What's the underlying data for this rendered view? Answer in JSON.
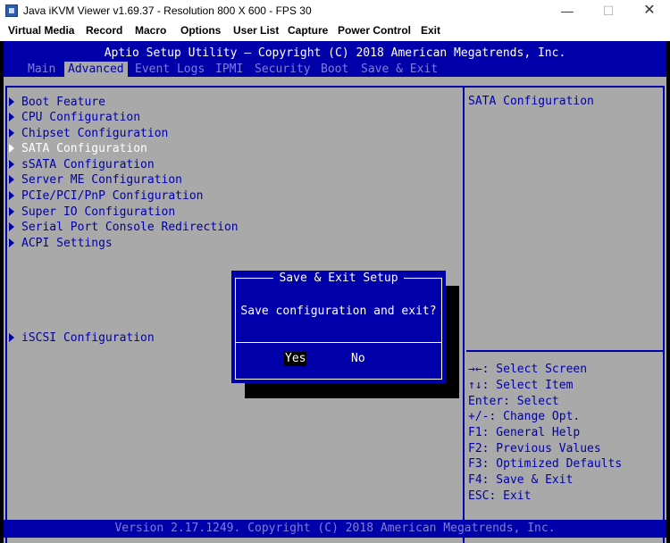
{
  "window": {
    "title": "Java iKVM Viewer v1.69.37 - Resolution 800 X 600 - FPS 30",
    "minimize_glyph": "—",
    "maximize_glyph": "☐",
    "close_glyph": "✕"
  },
  "menubar": [
    "Virtual Media",
    "Record",
    "Macro",
    "Options",
    "User List",
    "Capture",
    "Power Control",
    "Exit"
  ],
  "bios": {
    "header_title": "Aptio Setup Utility – Copyright (C) 2018 American Megatrends, Inc.",
    "tabs": [
      "Main",
      "Advanced",
      "Event Logs",
      "IPMI",
      "Security",
      "Boot",
      "Save & Exit"
    ],
    "active_tab": "Advanced",
    "menu_items": [
      "Boot Feature",
      "CPU Configuration",
      "Chipset Configuration",
      "SATA Configuration",
      "sSATA Configuration",
      "Server ME Configuration",
      "PCIe/PCI/PnP Configuration",
      "Super IO Configuration",
      "Serial Port Console Redirection",
      "ACPI Settings",
      "iSCSI Configuration"
    ],
    "selected_item": "SATA Configuration",
    "help_text": "SATA Configuration",
    "key_help": [
      "→←: Select Screen",
      "↑↓: Select Item",
      "Enter: Select",
      "+/-: Change Opt.",
      "F1: General Help",
      "F2: Previous Values",
      "F3: Optimized Defaults",
      "F4: Save & Exit",
      "ESC: Exit"
    ],
    "dialog": {
      "title": "Save & Exit Setup",
      "message": "Save configuration and exit?",
      "yes": "Yes",
      "no": "No"
    },
    "footer": "Version 2.17.1249. Copyright (C) 2018 American Megatrends, Inc.",
    "colors": {
      "bios_blue": "#0000aa",
      "bios_gray": "#a9a9a9",
      "dim_text": "#7f7fd6"
    }
  }
}
